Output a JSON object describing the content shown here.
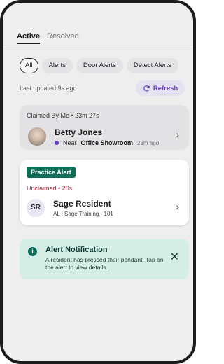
{
  "tabs": [
    {
      "label": "Active"
    },
    {
      "label": "Resolved"
    }
  ],
  "filters": [
    {
      "label": "All",
      "selected": true
    },
    {
      "label": "Alerts"
    },
    {
      "label": "Door Alerts"
    },
    {
      "label": "Detect Alerts"
    }
  ],
  "status": {
    "last_updated": "Last updated 9s ago",
    "refresh_label": "Refresh"
  },
  "claimed_card": {
    "meta": "Claimed By Me • 23m 27s",
    "resident_name": "Betty Jones",
    "location_prefix": "Near",
    "location": "Office Showroom",
    "time": "23m ago"
  },
  "practice_card": {
    "badge": "Practice Alert",
    "status": "Unclaimed • 20s",
    "initials": "SR",
    "resident_name": "Sage Resident",
    "subtitle": "AL | Sage Training - 101"
  },
  "notification": {
    "title": "Alert Notification",
    "body": "A resident has pressed their pendant. Tap on the alert to view details."
  },
  "colors": {
    "accent_purple": "#6c3fc8",
    "brand_green": "#0f6e58",
    "alert_red": "#b4253a",
    "notification_bg": "#d5efe7"
  }
}
